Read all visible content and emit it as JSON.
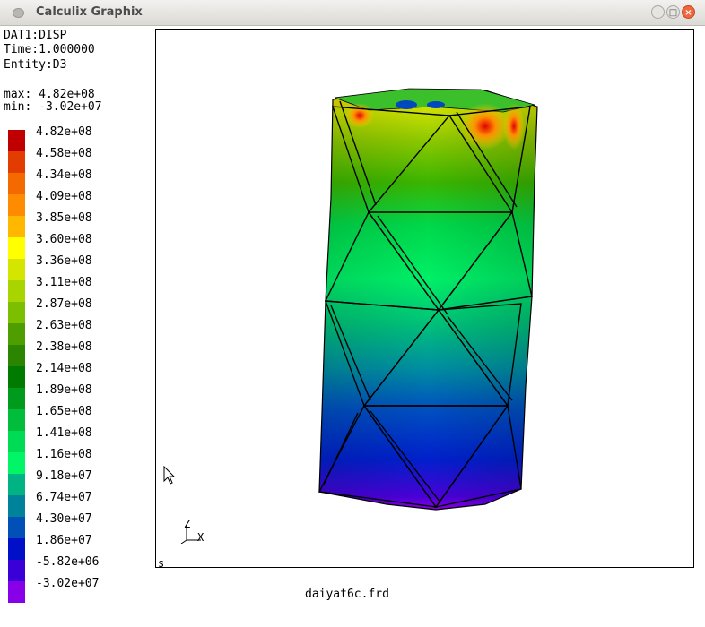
{
  "window": {
    "title": "Calculix Graphix",
    "min_symbol": "–",
    "max_symbol": "□",
    "close_symbol": "×"
  },
  "info": {
    "dataset": "DAT1:DISP",
    "time": "Time:1.000000",
    "entity": "Entity:D3",
    "max": "max: 4.82e+08",
    "min": "min: -3.02e+07"
  },
  "legend": [
    {
      "label": "4.82e+08",
      "color": "#c00000"
    },
    {
      "label": "4.58e+08",
      "color": "#e23c00"
    },
    {
      "label": "4.34e+08",
      "color": "#f56a00"
    },
    {
      "label": "4.09e+08",
      "color": "#ff8c00"
    },
    {
      "label": "3.85e+08",
      "color": "#ffb700"
    },
    {
      "label": "3.60e+08",
      "color": "#ffff00"
    },
    {
      "label": "3.36e+08",
      "color": "#d4e600"
    },
    {
      "label": "3.11e+08",
      "color": "#a8d400"
    },
    {
      "label": "2.87e+08",
      "color": "#7cbf00"
    },
    {
      "label": "2.63e+08",
      "color": "#4f9e00"
    },
    {
      "label": "2.38e+08",
      "color": "#2c8500"
    },
    {
      "label": "2.14e+08",
      "color": "#007a00"
    },
    {
      "label": "1.89e+08",
      "color": "#009a1c"
    },
    {
      "label": "1.65e+08",
      "color": "#00bd3c"
    },
    {
      "label": "1.41e+08",
      "color": "#00db55"
    },
    {
      "label": "1.16e+08",
      "color": "#00f567"
    },
    {
      "label": "9.18e+07",
      "color": "#00b383"
    },
    {
      "label": "6.74e+07",
      "color": "#00839a"
    },
    {
      "label": "4.30e+07",
      "color": "#0050b8"
    },
    {
      "label": "1.86e+07",
      "color": "#0010c8"
    },
    {
      "label": "-5.82e+06",
      "color": "#3a00d8"
    },
    {
      "label": "-3.02e+07",
      "color": "#8800e8"
    }
  ],
  "viewport": {
    "axis_z": "Z",
    "axis_x": "X",
    "corner_label": "s"
  },
  "filename": "daiyat6c.frd"
}
